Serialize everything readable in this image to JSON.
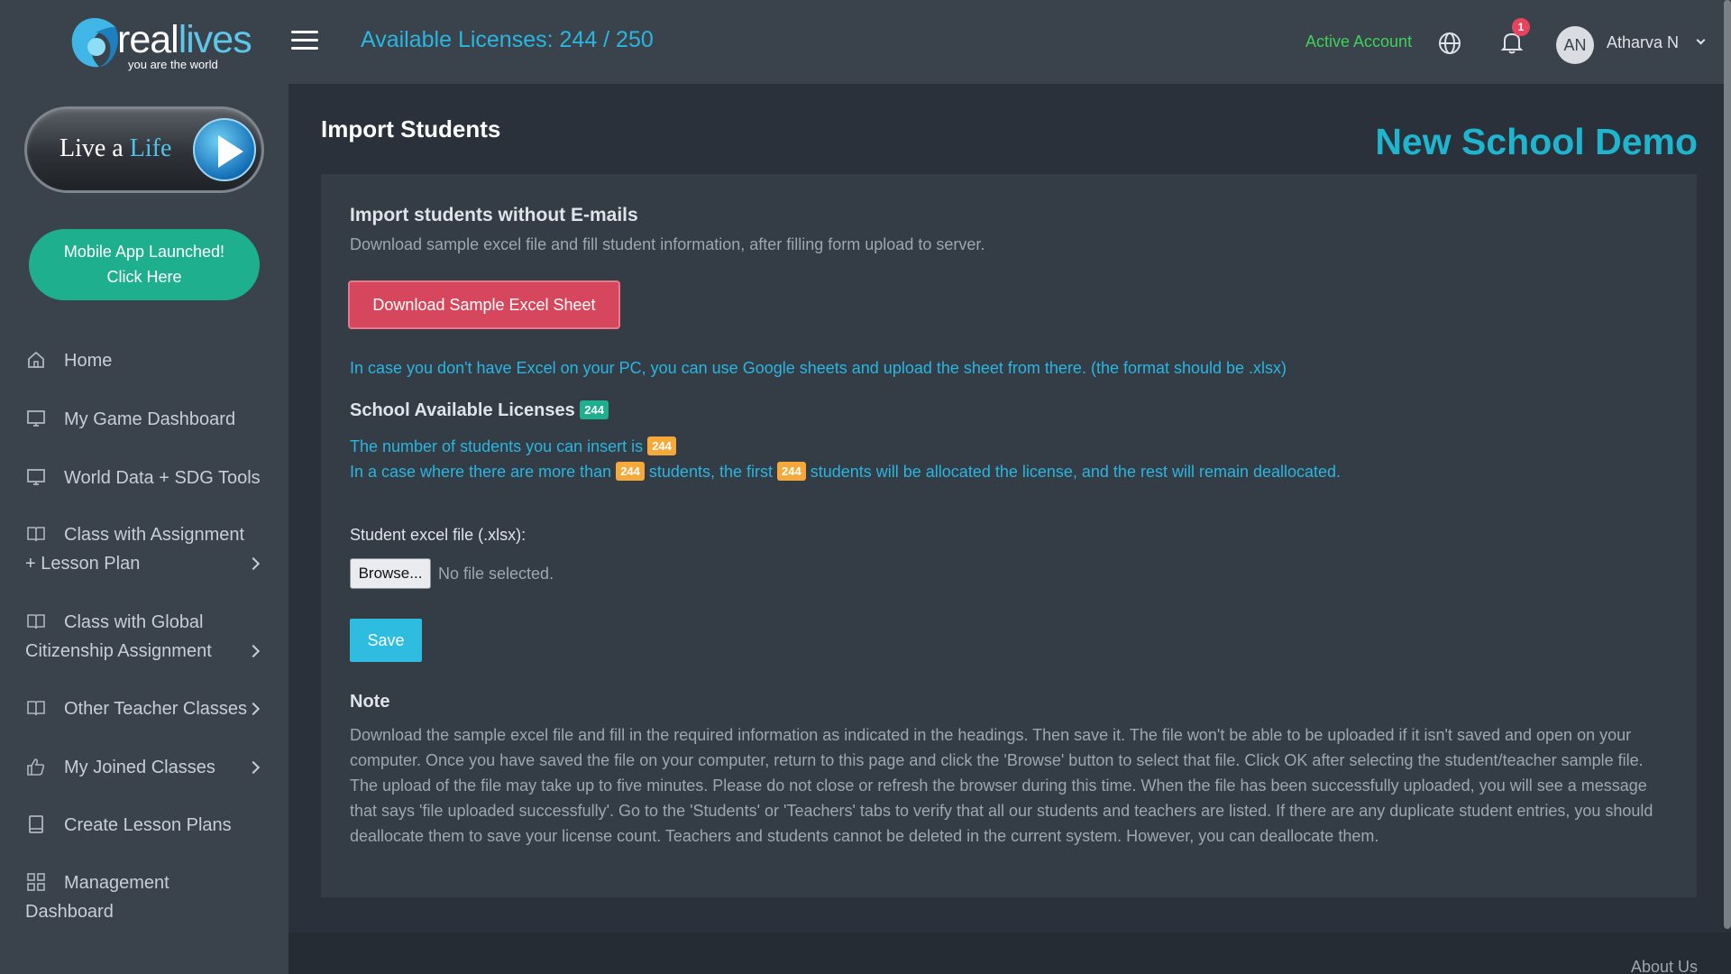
{
  "brand": {
    "name_part1": "real",
    "name_part2": "lives",
    "tagline": "you are the world"
  },
  "sidebar": {
    "live_life_word1": "Live a",
    "live_life_word2": "Life",
    "mobile_line1": "Mobile App Launched!",
    "mobile_line2": "Click Here",
    "items": [
      {
        "label": "Home",
        "icon": "home-icon"
      },
      {
        "label": "My Game Dashboard",
        "icon": "monitor-icon"
      },
      {
        "label": "World Data + SDG Tools",
        "icon": "monitor-icon"
      },
      {
        "label_line1": "Class with Assignment",
        "label_line2": "+ Lesson Plan",
        "icon": "book-icon"
      },
      {
        "label_line1": "Class with Global",
        "label_line2": "Citizenship Assignment",
        "icon": "book-icon"
      },
      {
        "label": "Other Teacher Classes",
        "icon": "book-icon"
      },
      {
        "label": "My Joined Classes",
        "icon": "thumbs-up-icon"
      },
      {
        "label": "Create Lesson Plans",
        "icon": "book-open-icon"
      },
      {
        "label_line1": "Management",
        "label_line2": "Dashboard",
        "icon": "grid-icon"
      }
    ]
  },
  "header": {
    "licenses": "Available Licenses: 244 / 250",
    "account_status": "Active Account",
    "notification_count": "1",
    "avatar_initials": "AN",
    "user_name": "Atharva N"
  },
  "main": {
    "title": "Import Students",
    "school": "New School Demo",
    "heading": "Import students without E-mails",
    "subheading": "Download sample excel file and fill student information, after filling form upload to server.",
    "download_button": "Download Sample Excel Sheet",
    "excel_info": "In case you don't have Excel on your PC, you can use Google sheets and upload the sheet from there. (the format should be .xlsx)",
    "licenses_label": "School Available Licenses",
    "licenses_count": "244",
    "line1_text": "The number of students you can insert is",
    "line2_a": "In a case where there are more than",
    "line2_b": "students, the first",
    "line2_c": "students will be allocated the license, and the rest will remain deallocated.",
    "file_label": "Student excel file (.xlsx):",
    "browse_button": "Browse...",
    "no_file": "No file selected.",
    "save_button": "Save",
    "note_heading": "Note",
    "note_body": "Download the sample excel file and fill in the required information as indicated in the headings. Then save it. The file won't be able to be uploaded if it isn't saved and open on your computer. Once you have saved the file on your computer, return to this page and click the 'Browse' button to select that file. Click OK after selecting the student/teacher sample file. The upload of the file may take up to five minutes. Please do not close or refresh the browser during this time. When the file has been successfully uploaded, you will see a message that says 'file uploaded successfully'. Go to the 'Students' or 'Teachers' tabs to verify that all our students and teachers are listed. If there are any duplicate student entries, you should deallocate them to save your license count. Teachers and students cannot be deleted in the current system. However, you can deallocate them."
  },
  "footer": {
    "about": "About Us"
  },
  "colors": {
    "accent": "#29b6e0",
    "danger": "#d6475d",
    "success": "#1eaf8e",
    "warning": "#f4a93a"
  }
}
